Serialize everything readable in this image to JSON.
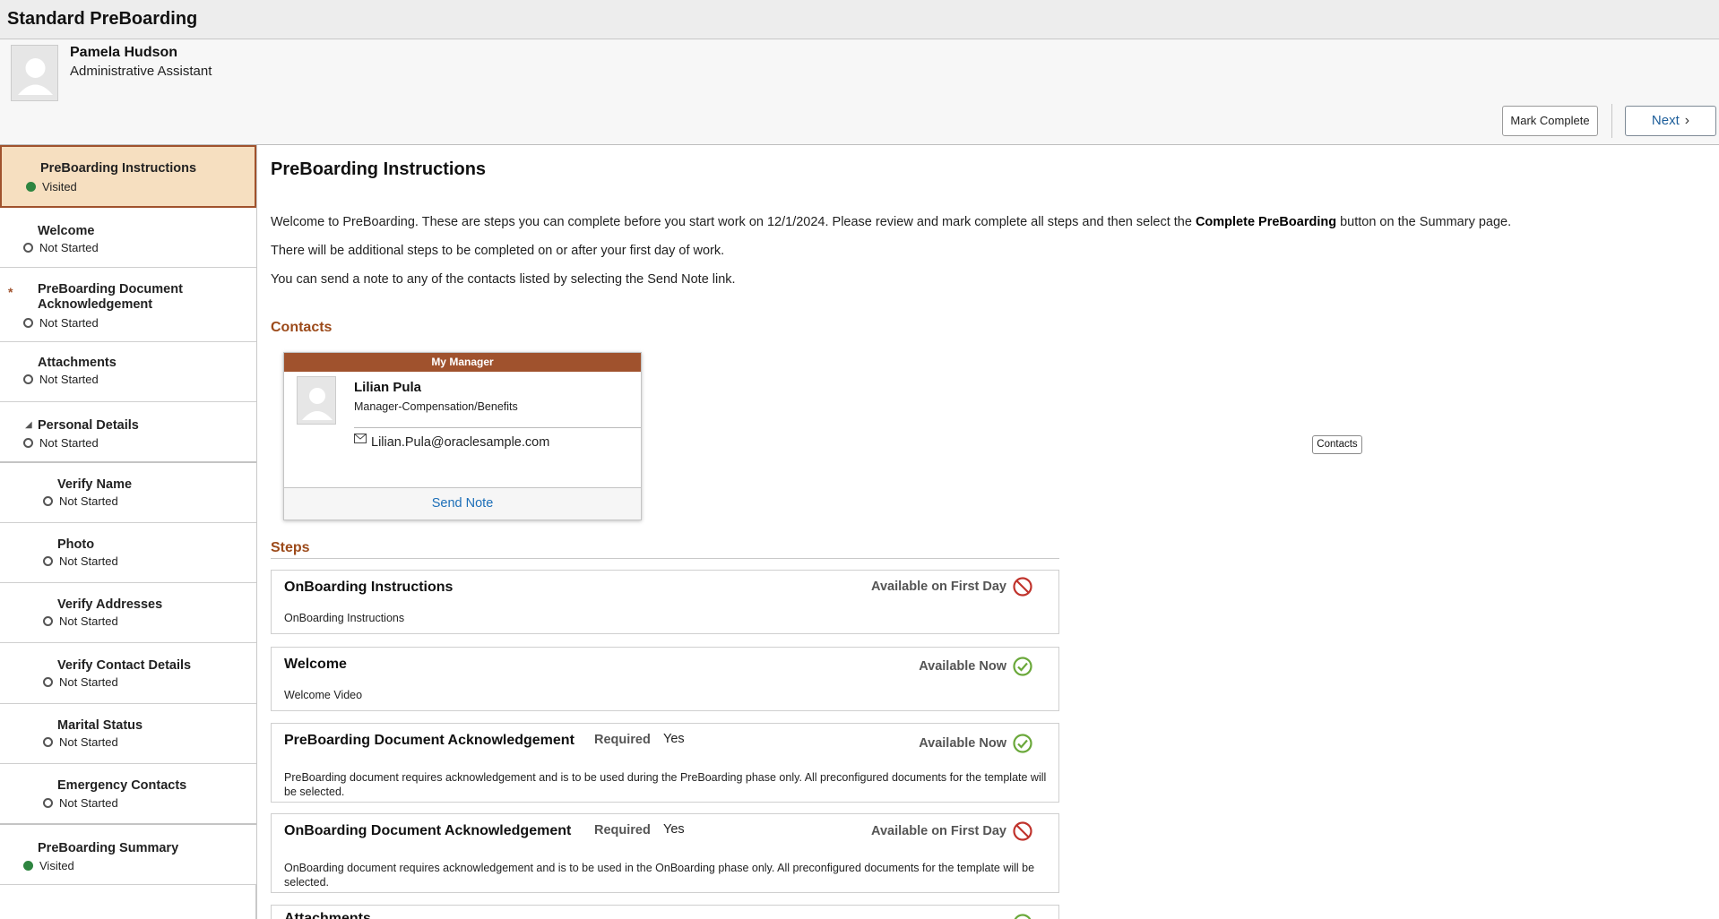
{
  "banner": {
    "title": "Standard PreBoarding"
  },
  "person": {
    "name": "Pamela Hudson",
    "title": "Administrative Assistant"
  },
  "actions": {
    "mark_complete": "Mark Complete",
    "next": "Next"
  },
  "sidebar": {
    "items": [
      {
        "label": "PreBoarding Instructions",
        "status": "Visited"
      },
      {
        "label": "Welcome",
        "status": "Not Started"
      },
      {
        "label": "PreBoarding Document Acknowledgement",
        "status": "Not Started",
        "required_marker": "*"
      },
      {
        "label": "Attachments",
        "status": "Not Started"
      },
      {
        "label": "Personal Details",
        "status": "Not Started"
      },
      {
        "label": "Verify Name",
        "status": "Not Started"
      },
      {
        "label": "Photo",
        "status": "Not Started"
      },
      {
        "label": "Verify Addresses",
        "status": "Not Started"
      },
      {
        "label": "Verify Contact Details",
        "status": "Not Started"
      },
      {
        "label": "Marital Status",
        "status": "Not Started"
      },
      {
        "label": "Emergency Contacts",
        "status": "Not Started"
      },
      {
        "label": "PreBoarding Summary",
        "status": "Visited"
      }
    ]
  },
  "main": {
    "title": "PreBoarding Instructions",
    "intro_1a": "Welcome to PreBoarding. These are steps you can complete before you start work on 12/1/2024. Please review and mark complete all steps and then select the",
    "intro_1b": "Complete PreBoarding",
    "intro_1c": "button on the Summary page.",
    "intro_2": "There will be additional steps to be completed on or after your first day of work.",
    "intro_3": "You can send a note to any of the contacts listed by selecting the Send Note link.",
    "contacts_heading": "Contacts",
    "contacts_button": "Contacts",
    "steps_heading": "Steps"
  },
  "contact_card": {
    "header": "My Manager",
    "name": "Lilian Pula",
    "role": "Manager-Compensation/Benefits",
    "email": "Lilian.Pula@oraclesample.com",
    "send_note": "Send Note"
  },
  "steps": [
    {
      "title": "OnBoarding Instructions",
      "availability": "Available on First Day",
      "status_icon": "not-available-icon",
      "description": "OnBoarding Instructions"
    },
    {
      "title": "Welcome",
      "availability": "Available Now",
      "status_icon": "available-check-icon",
      "description": "Welcome Video"
    },
    {
      "title": "PreBoarding Document Acknowledgement",
      "required_label": "Required",
      "required_value": "Yes",
      "availability": "Available Now",
      "status_icon": "available-check-icon",
      "description": "PreBoarding document requires acknowledgement and is to be used during the PreBoarding phase only. All preconfigured documents for the template will be selected."
    },
    {
      "title": "OnBoarding Document Acknowledgement",
      "required_label": "Required",
      "required_value": "Yes",
      "availability": "Available on First Day",
      "status_icon": "not-available-icon",
      "description": "OnBoarding document requires acknowledgement and is to be used in the OnBoarding phase only. All preconfigured documents for the template will be selected."
    },
    {
      "title": "Attachments",
      "availability": "",
      "status_icon": "available-check-icon",
      "description": ""
    }
  ],
  "colors": {
    "accent": "#a0522d",
    "active_nav_bg": "#f6dfc0",
    "visited_dot": "#2e8540",
    "link": "#1d6fb8",
    "available_icon": "#6aa83a",
    "unavailable_icon": "#c0332c"
  }
}
